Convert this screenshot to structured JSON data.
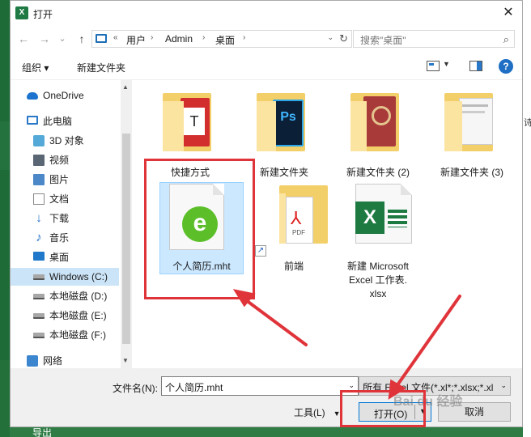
{
  "background": {
    "bottom_text": "导出",
    "right_mark": "诗"
  },
  "dialog": {
    "title": "打开",
    "close_glyph": "✕",
    "app_icon_letter": "X"
  },
  "nav": {
    "back_glyph": "←",
    "forward_glyph": "→",
    "recent_glyph": "⌄",
    "up_glyph": "↑",
    "breadcrumbs": [
      "用户",
      "Admin",
      "桌面"
    ],
    "overflow": "«",
    "separator": "›",
    "search_placeholder": "搜索\"桌面\""
  },
  "toolbar": {
    "organize": "组织 ▾",
    "new_folder": "新建文件夹",
    "help": "?"
  },
  "sidebar": {
    "items": [
      {
        "label": "OneDrive",
        "icon": "cloud-icon"
      },
      {
        "label": "此电脑",
        "icon": "computer-icon"
      },
      {
        "label": "3D 对象",
        "icon": "3d-objects-icon"
      },
      {
        "label": "视频",
        "icon": "video-icon"
      },
      {
        "label": "图片",
        "icon": "pictures-icon"
      },
      {
        "label": "文档",
        "icon": "documents-icon"
      },
      {
        "label": "下载",
        "icon": "download-icon"
      },
      {
        "label": "音乐",
        "icon": "music-icon"
      },
      {
        "label": "桌面",
        "icon": "desktop-icon"
      },
      {
        "label": "Windows (C:)",
        "icon": "drive-icon",
        "selected": true
      },
      {
        "label": "本地磁盘 (D:)",
        "icon": "drive-icon"
      },
      {
        "label": "本地磁盘 (E:)",
        "icon": "drive-icon"
      },
      {
        "label": "本地磁盘 (F:)",
        "icon": "drive-icon"
      },
      {
        "label": "网络",
        "icon": "network-icon"
      }
    ]
  },
  "files": [
    {
      "name": "快捷方式",
      "type": "folder"
    },
    {
      "name": "新建文件夹",
      "type": "folder"
    },
    {
      "name": "新建文件夹 (2)",
      "type": "folder"
    },
    {
      "name": "新建文件夹 (3)",
      "type": "folder"
    },
    {
      "name": "个人简历.mht",
      "type": "mht-file",
      "selected": true
    },
    {
      "name": "前端",
      "type": "folder-shortcut"
    },
    {
      "name": "新建 Microsoft Excel 工作表.xlsx",
      "type": "excel-file",
      "line1": "新建 Microsoft",
      "line2": "Excel 工作表.",
      "line3": "xlsx"
    }
  ],
  "bottom": {
    "filename_label": "文件名(N):",
    "filename_value": "个人简历.mht",
    "filter_value": "所有 Excel 文件(*.xl*;*.xlsx;*.xl",
    "tools": "工具(L)",
    "open": "打开(O)",
    "cancel": "取消"
  },
  "watermark": "Bai du 经验",
  "colors": {
    "highlight": "#e0343b",
    "selection": "#cce8ff",
    "accent": "#0078d7"
  }
}
